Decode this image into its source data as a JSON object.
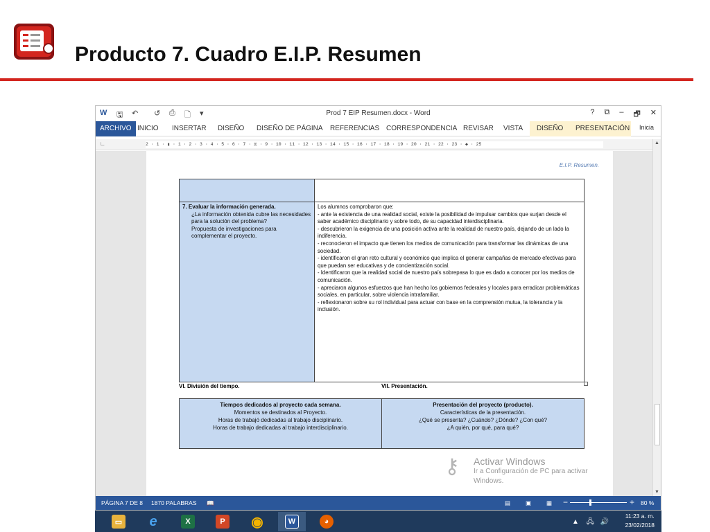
{
  "slide": {
    "title": "Producto 7. Cuadro E.I.P. Resumen",
    "accent": "#d3261f"
  },
  "word": {
    "doc_title": "Prod 7 EIP Resumen.docx - Word",
    "window_controls": [
      "?",
      "⧉",
      "–",
      "🗗",
      "✕"
    ],
    "ribbon_tabs": [
      "ARCHIVO",
      "INICIO",
      "INSERTAR",
      "DISEÑO",
      "DISEÑO DE PÁGINA",
      "REFERENCIAS",
      "CORRESPONDENCIA",
      "REVISAR",
      "VISTA",
      "DISEÑO",
      "PRESENTACIÓN"
    ],
    "signin": "Inicia",
    "ruler_text": "2 · 1 · ▮ · 1 · 2 · 3 · 4 · 5 · 6 · 7 · ⧖ · 9 · 10 · 11 · 12 · 13 · 14 · 15 · 16 · 17 · 18 · 19 · 20 · 21 · 22 · 23 · ◆ · 25",
    "header_note": "E.I.P. Resumen.",
    "q7": {
      "title": "7.  Evaluar la información generada.",
      "text": "¿La información obtenida cubre las necesidades para la solución del problema?\nPropuesta de investigaciones para complementar el proyecto."
    },
    "answer": "Los alumnos comprobaron que:\n- ante la existencia de una realidad social, existe la posibilidad de impulsar cambios que surjan desde el saber académico disciplinario y sobre todo, de su capacidad interdisciplinaria.\n- descubrieron la exigencia de una posición activa ante la realidad de nuestro país, dejando de un lado la indiferencia.\n- reconocieron el impacto que tienen los medios de comunicación para transformar las dinámicas de una sociedad.\n- identificaron el gran reto cultural y económico que implica el generar campañas de mercado efectivas para que puedan ser educativas y de concientización social.\n - Identificaron que la realidad social de nuestro país sobrepasa lo que es dado a conocer por los medios de comunicación.\n- apreciaron algunos esfuerzos que han hecho los gobiernos federales y locales para erradicar problemáticas sociales, en particular, sobre violencia intrafamiliar.\n- reflexionaron sobre su rol individual para actuar con base en la comprensión mutua, la tolerancia y la inclusión.",
    "section6": "VI. División del tiempo.",
    "section7": "VII. Presentación.",
    "time_box": {
      "title": "Tiempos dedicados al proyecto cada semana.",
      "lines": [
        "Momentos  se destinados al Proyecto.",
        "Horas de trabajó dedicadas al trabajo disciplinario.",
        "Horas de trabajo dedicadas al trabajo interdisciplinario."
      ]
    },
    "presentation_box": {
      "title": "Presentación del proyecto (producto).",
      "lines": [
        "Características de la presentación.",
        "¿Qué se presenta? ¿Cuándo? ¿Dónde? ¿Con qué?",
        "¿A quién, por qué, para qué?"
      ]
    },
    "watermark": {
      "title": "Activar Windows",
      "line1": "Ir a Configuración de PC para activar",
      "line2": "Windows."
    },
    "status": {
      "page": "PÁGINA 7 DE 8",
      "words": "1870 PALABRAS",
      "zoom": "80 %",
      "zoom_minus": "−",
      "zoom_plus": "+"
    }
  },
  "taskbar": {
    "apps": [
      {
        "name": "file-explorer",
        "glyph": "📁",
        "color": "#e8b33d"
      },
      {
        "name": "internet-explorer",
        "glyph": "e",
        "color": "#1e88e5"
      },
      {
        "name": "excel",
        "glyph": "X",
        "color": "#1e7145"
      },
      {
        "name": "powerpoint",
        "glyph": "P",
        "color": "#d24726"
      },
      {
        "name": "chrome",
        "glyph": "◉",
        "color": "#db4437"
      },
      {
        "name": "word",
        "glyph": "W",
        "color": "#2b579a"
      },
      {
        "name": "firefox",
        "glyph": "🦊",
        "color": "#e66000"
      }
    ],
    "time": "11:23 a. m.",
    "date": "23/02/2018"
  }
}
